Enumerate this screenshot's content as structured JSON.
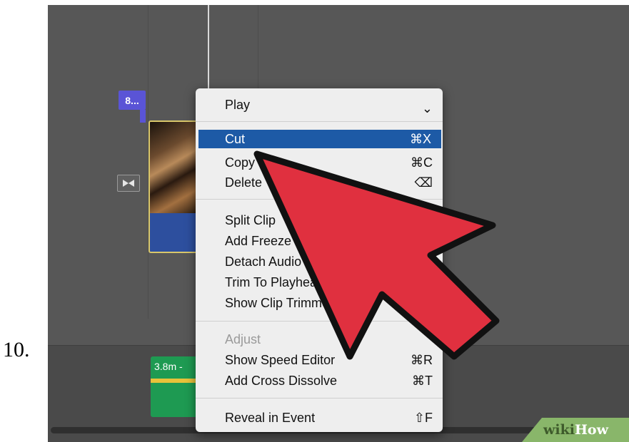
{
  "step_number": "10.",
  "timeline": {
    "clip_tag": "8...",
    "green_clip_label": "3.8m -"
  },
  "context_menu": {
    "items": [
      {
        "label": "Play",
        "shortcut": "⌄"
      },
      {
        "label": "Cut",
        "shortcut": "⌘X",
        "highlighted": true
      },
      {
        "label": "Copy",
        "shortcut": "⌘C"
      },
      {
        "label": "Delete",
        "shortcut": "⌫"
      },
      {
        "label": "Split Clip",
        "shortcut": ""
      },
      {
        "label": "Add Freeze",
        "shortcut": ""
      },
      {
        "label": "Detach Audio",
        "shortcut": ""
      },
      {
        "label": "Trim To Playhead",
        "shortcut": ""
      },
      {
        "label": "Show Clip Trimmer",
        "shortcut": ""
      },
      {
        "label": "Adjust",
        "shortcut": "",
        "disabled": true
      },
      {
        "label": "Show Speed Editor",
        "shortcut": "⌘R"
      },
      {
        "label": "Add Cross Dissolve",
        "shortcut": "⌘T"
      },
      {
        "label": "Reveal in Event",
        "shortcut": "⇧F"
      }
    ]
  },
  "watermark": {
    "part1": "wiki",
    "part2": "How"
  },
  "colors": {
    "menu_highlight": "#1d5aa6",
    "arrow_fill": "#e0303f",
    "clip_tag": "#5a54d6",
    "green_clip": "#1e9a52"
  }
}
